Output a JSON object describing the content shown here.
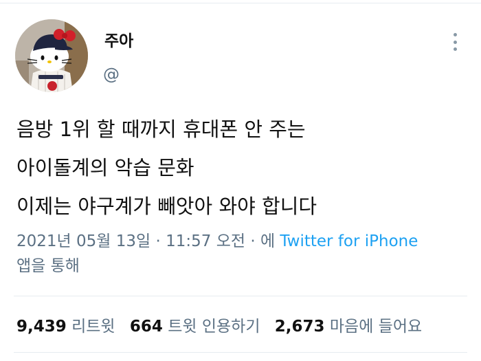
{
  "user": {
    "display_name": "주아",
    "handle": "@"
  },
  "tweet": {
    "lines": [
      "음방 1위 할 때까지 휴대폰 안 주는",
      "아이돌계의 악습 문화",
      "이제는 야구계가 빼앗아 와야 합니다"
    ]
  },
  "meta": {
    "timestamp": "2021년 05월 13일 · 11:57 오전 · 에",
    "source": "Twitter for iPhone",
    "via": "앱을 통해"
  },
  "stats": {
    "retweets": "9,439",
    "retweets_label": "리트윗",
    "quotes": "664",
    "quotes_label": "트윗 인용하기",
    "likes": "2,673",
    "likes_label": "마음에 들어요"
  },
  "icons": {
    "more": "more-vertical-icon",
    "avatar": "hello-kitty-avatar"
  },
  "colors": {
    "link": "#1da1f2",
    "secondary_text": "#5b7083",
    "divider": "#e6ecf0"
  }
}
